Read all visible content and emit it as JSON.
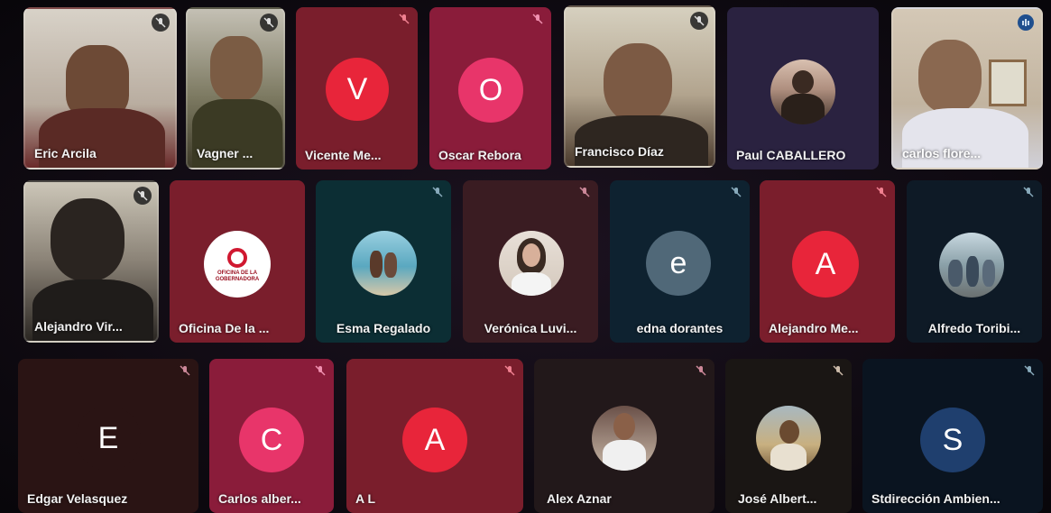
{
  "participants": [
    {
      "name": "Eric Arcila",
      "type": "video",
      "muted": true
    },
    {
      "name": "Vagner ...",
      "type": "video",
      "muted": true
    },
    {
      "name": "Vicente Me...",
      "type": "letter",
      "letter": "V",
      "muted": true
    },
    {
      "name": "Oscar Rebora",
      "type": "letter",
      "letter": "O",
      "muted": true
    },
    {
      "name": "Francisco Díaz",
      "type": "video",
      "muted": true
    },
    {
      "name": "Paul CABALLERO",
      "type": "photo",
      "muted": false
    },
    {
      "name": "carlos flore...",
      "type": "video",
      "muted": false
    },
    {
      "name": "Alejandro Vir...",
      "type": "video",
      "muted": true
    },
    {
      "name": "Oficina De la ...",
      "type": "logo",
      "logo_text": "OFICINA DE LA GOBERNADORA",
      "muted": false
    },
    {
      "name": "Esma Regalado",
      "type": "photo",
      "muted": true
    },
    {
      "name": "Verónica Luvi...",
      "type": "photo",
      "muted": true
    },
    {
      "name": "edna dorantes",
      "type": "letter",
      "letter": "e",
      "muted": true
    },
    {
      "name": "Alejandro Me...",
      "type": "letter",
      "letter": "A",
      "muted": true
    },
    {
      "name": "Alfredo Toribi...",
      "type": "photo",
      "muted": true
    },
    {
      "name": "Edgar Velasquez",
      "type": "letter",
      "letter": "E",
      "muted": true
    },
    {
      "name": "Carlos alber...",
      "type": "letter",
      "letter": "C",
      "muted": true
    },
    {
      "name": "A L",
      "type": "letter",
      "letter": "A",
      "muted": true
    },
    {
      "name": "Alex Aznar",
      "type": "photo",
      "muted": true
    },
    {
      "name": "José Albert...",
      "type": "photo",
      "muted": true
    },
    {
      "name": "Stdirección Ambien...",
      "type": "letter",
      "letter": "S",
      "muted": true
    }
  ],
  "colors": {
    "accent_red": "#e8253a",
    "accent_pink": "#e8356a",
    "slate": "#506878",
    "navy": "#1f3f6e"
  },
  "icons": {
    "mic_off": "mic-off-icon",
    "speaking": "audio-level-icon"
  }
}
